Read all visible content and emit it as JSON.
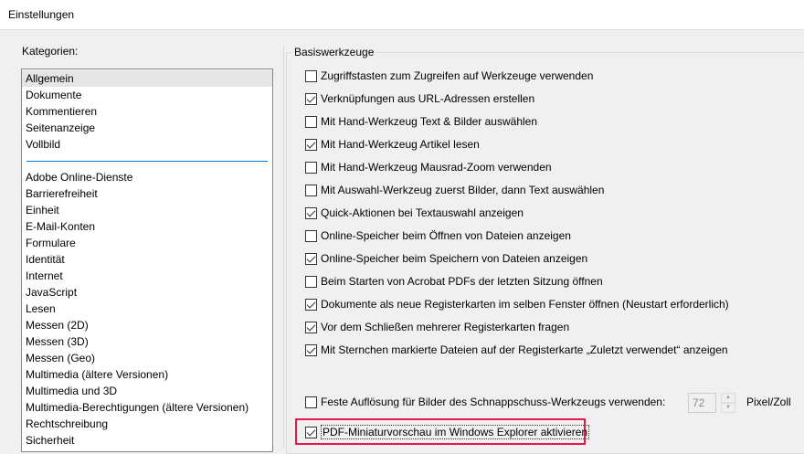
{
  "window": {
    "title": "Einstellungen"
  },
  "sidebar": {
    "label": "Kategorien:",
    "group1": [
      "Allgemein",
      "Dokumente",
      "Kommentieren",
      "Seitenanzeige",
      "Vollbild"
    ],
    "group2": [
      "Adobe Online-Dienste",
      "Barrierefreiheit",
      "Einheit",
      "E-Mail-Konten",
      "Formulare",
      "Identität",
      "Internet",
      "JavaScript",
      "Lesen",
      "Messen (2D)",
      "Messen (3D)",
      "Messen (Geo)",
      "Multimedia (ältere Versionen)",
      "Multimedia und 3D",
      "Multimedia-Berechtigungen (ältere Versionen)",
      "Rechtschreibung",
      "Sicherheit"
    ],
    "selected": "Allgemein"
  },
  "main": {
    "group_label": "Basiswerkzeuge",
    "options": [
      {
        "label": "Zugriffstasten zum Zugreifen auf Werkzeuge verwenden",
        "checked": false
      },
      {
        "label": "Verknüpfungen aus URL-Adressen erstellen",
        "checked": true
      },
      {
        "label": "Mit Hand-Werkzeug Text & Bilder auswählen",
        "checked": false
      },
      {
        "label": "Mit Hand-Werkzeug Artikel lesen",
        "checked": true
      },
      {
        "label": "Mit Hand-Werkzeug Mausrad-Zoom verwenden",
        "checked": false
      },
      {
        "label": "Mit Auswahl-Werkzeug zuerst Bilder, dann Text auswählen",
        "checked": false
      },
      {
        "label": "Quick-Aktionen bei Textauswahl anzeigen",
        "checked": true
      },
      {
        "label": "Online-Speicher beim Öffnen von Dateien anzeigen",
        "checked": false
      },
      {
        "label": "Online-Speicher beim Speichern von Dateien anzeigen",
        "checked": true
      },
      {
        "label": "Beim Starten von Acrobat PDFs der letzten Sitzung öffnen",
        "checked": false
      },
      {
        "label": "Dokumente als neue Registerkarten im selben Fenster öffnen (Neustart erforderlich)",
        "checked": true
      },
      {
        "label": "Vor dem Schließen mehrerer Registerkarten fragen",
        "checked": true
      },
      {
        "label": "Mit Sternchen markierte Dateien auf der Registerkarte „Zuletzt verwendet“ anzeigen",
        "checked": true
      }
    ],
    "snapshot": {
      "label": "Feste Auflösung für Bilder des Schnappschuss-Werkzeugs verwenden:",
      "checked": false,
      "value": "72",
      "unit": "Pixel/Zoll"
    },
    "thumbnail": {
      "label": "PDF-Miniaturvorschau im Windows Explorer aktivieren",
      "checked": true
    },
    "highlight_color": "#e8174a"
  }
}
